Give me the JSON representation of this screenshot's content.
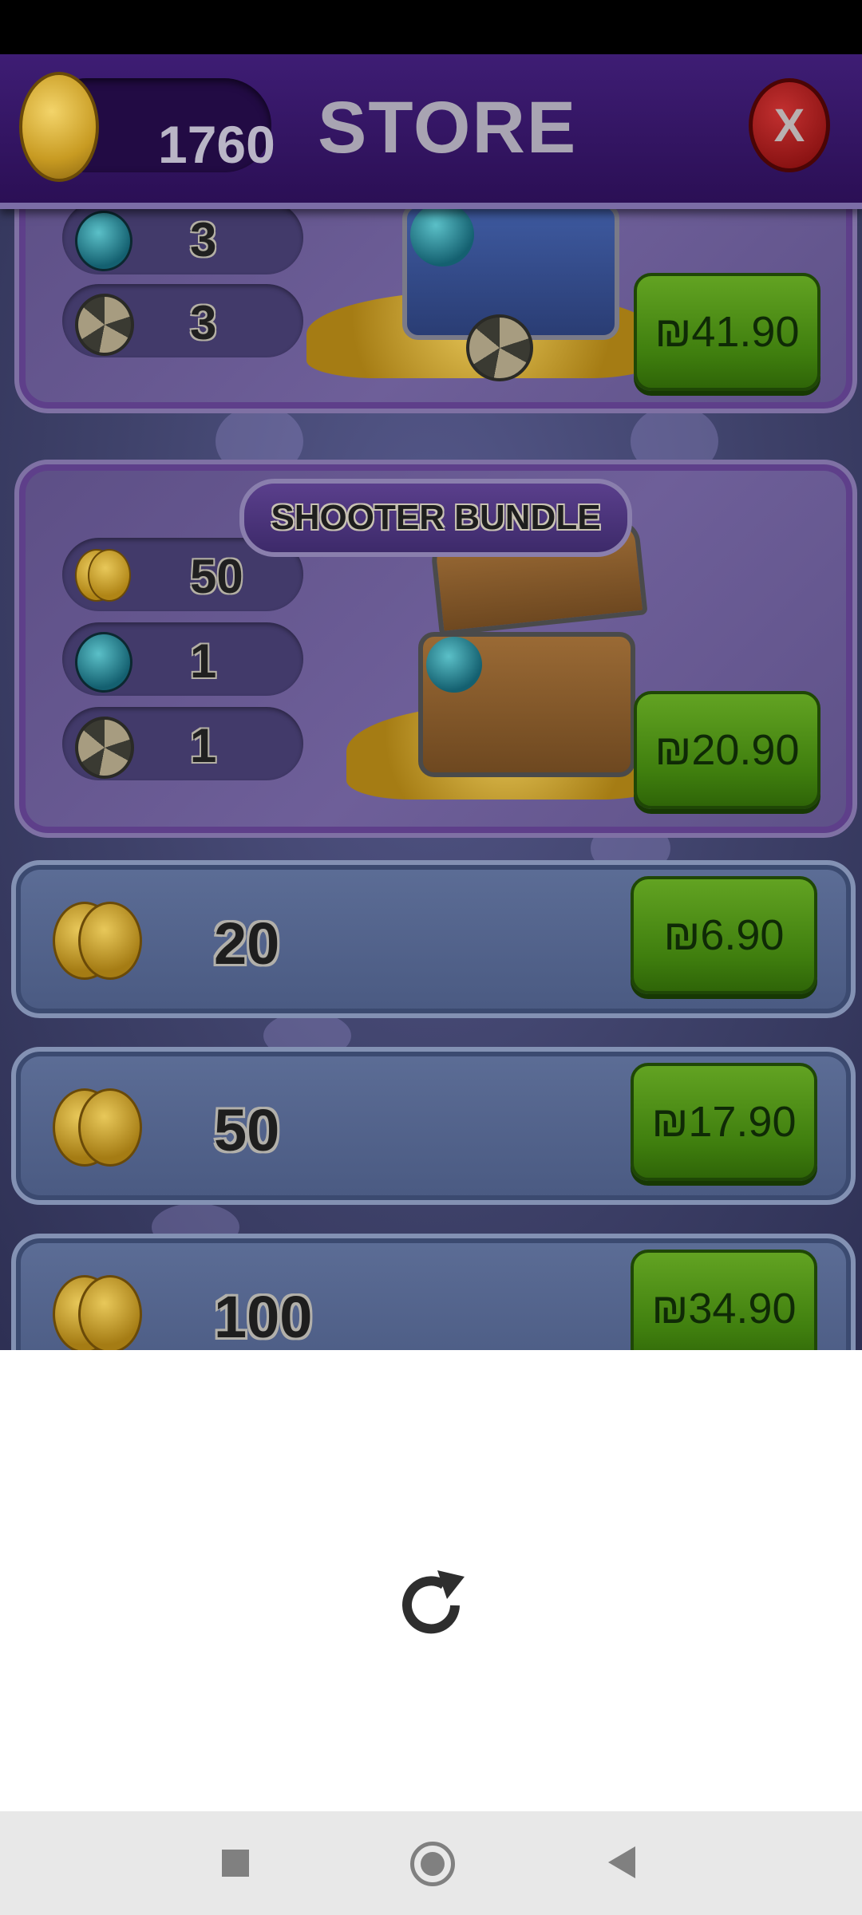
{
  "header": {
    "coin_balance": "1760",
    "title": "STORE",
    "close_label": "X"
  },
  "bundles": [
    {
      "name": "",
      "items": [
        {
          "icon": "gem-icon",
          "value": "3"
        },
        {
          "icon": "ball-icon",
          "value": "3"
        }
      ],
      "price": "₪41.90"
    },
    {
      "name": "SHOOTER BUNDLE",
      "items": [
        {
          "icon": "coin-icon",
          "value": "50"
        },
        {
          "icon": "gem-icon",
          "value": "1"
        },
        {
          "icon": "ball-icon",
          "value": "1"
        }
      ],
      "price": "₪20.90"
    }
  ],
  "coin_packs": [
    {
      "amount": "20",
      "price": "₪6.90"
    },
    {
      "amount": "50",
      "price": "₪17.90"
    },
    {
      "amount": "100",
      "price": "₪34.90"
    }
  ],
  "colors": {
    "header_bg": "#2b0f55",
    "price_button": "#4f8f18",
    "bundle_bg": "#6e5f99",
    "coin_row_bg": "#5c6d96"
  },
  "icons": {
    "reload": "reload-icon",
    "nav_recents": "square-icon",
    "nav_home": "circle-icon",
    "nav_back": "triangle-back-icon"
  }
}
